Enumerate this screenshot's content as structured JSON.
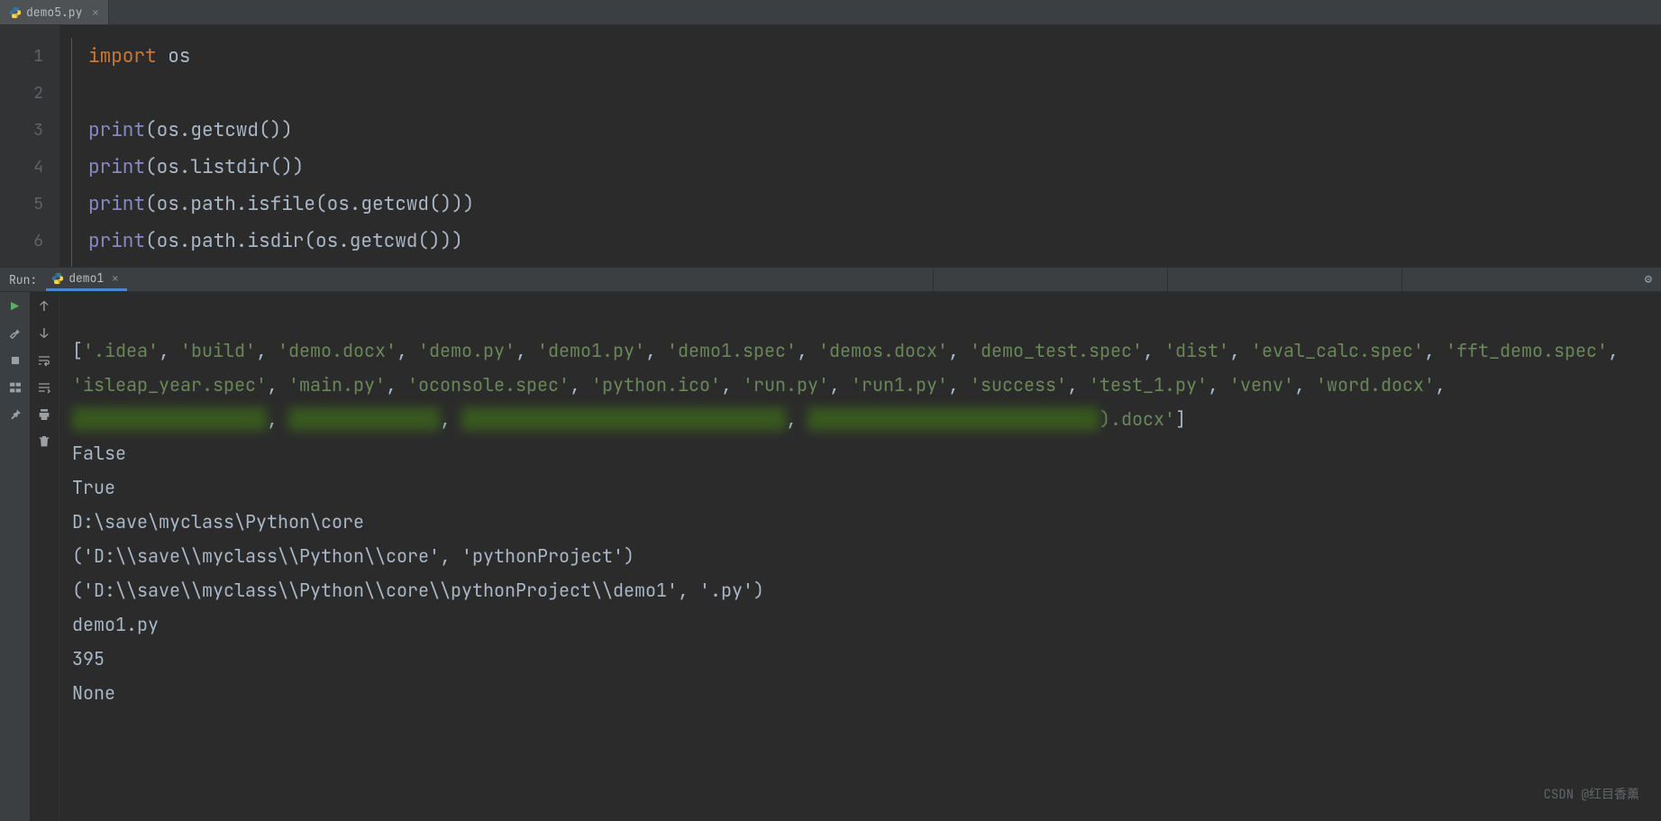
{
  "editor_tab": {
    "filename": "demo5.py"
  },
  "gutter": [
    "1",
    "2",
    "3",
    "4",
    "5",
    "6"
  ],
  "code": {
    "l1_kw": "import",
    "l1_nm": " os",
    "l2": "",
    "l3_fn": "print",
    "l3_rest": "(os.getcwd())",
    "l4_fn": "print",
    "l4_rest": "(os.listdir())",
    "l5_fn": "print",
    "l5_rest": "(os.path.isfile(os.getcwd()))",
    "l6_fn": "print",
    "l6_rest": "(os.path.isdir(os.getcwd()))"
  },
  "run": {
    "label": "Run:",
    "tab_name": "demo1"
  },
  "output": {
    "list_parts": {
      "p0": "[",
      "p1": "'.idea'",
      "c": ", ",
      "p2": "'build'",
      "p3": "'demo.docx'",
      "p4": "'demo.py'",
      "p5": "'demo1.py'",
      "p6": "'demo1.spec'",
      "p7": "'demos.docx'",
      "p8": "'demo_test.spec'",
      "p9": "'dist'",
      "p10": "'eval_calc.spec'",
      "p11": "'fft_demo.spec'",
      "p12": "'isleap_year.spec'",
      "p13": "'main.py'",
      "p14": "'oconsole.spec'",
      "p15": "'python.ico'",
      "p16": "'run.py'",
      "p17": "'run1.py'",
      "p18": "'success'",
      "p19": "'test_1.py'",
      "p20": "'venv'",
      "p21": "'word.docx'",
      "r1": "'xxxxxxxxxxxxxxxx'",
      "r2": "'xxxxxxxxxxxx'",
      "r3": "'xxxxxxxxxxxxxxxxxxxxxxxxxxxx'",
      "r4a": "'xxxxxxxxxxxxxxxxxxxxxxxxxx",
      "r4b": ").docx'",
      "close": "]"
    },
    "l2": "False",
    "l3": "True",
    "l4": "D:\\save\\myclass\\Python\\core",
    "l5": "('D:\\\\save\\\\myclass\\\\Python\\\\core', 'pythonProject')",
    "l6": "('D:\\\\save\\\\myclass\\\\Python\\\\core\\\\pythonProject\\\\demo1', '.py')",
    "l7": "demo1.py",
    "l8": "395",
    "l9": "None"
  },
  "watermark": "CSDN @红目香薰"
}
